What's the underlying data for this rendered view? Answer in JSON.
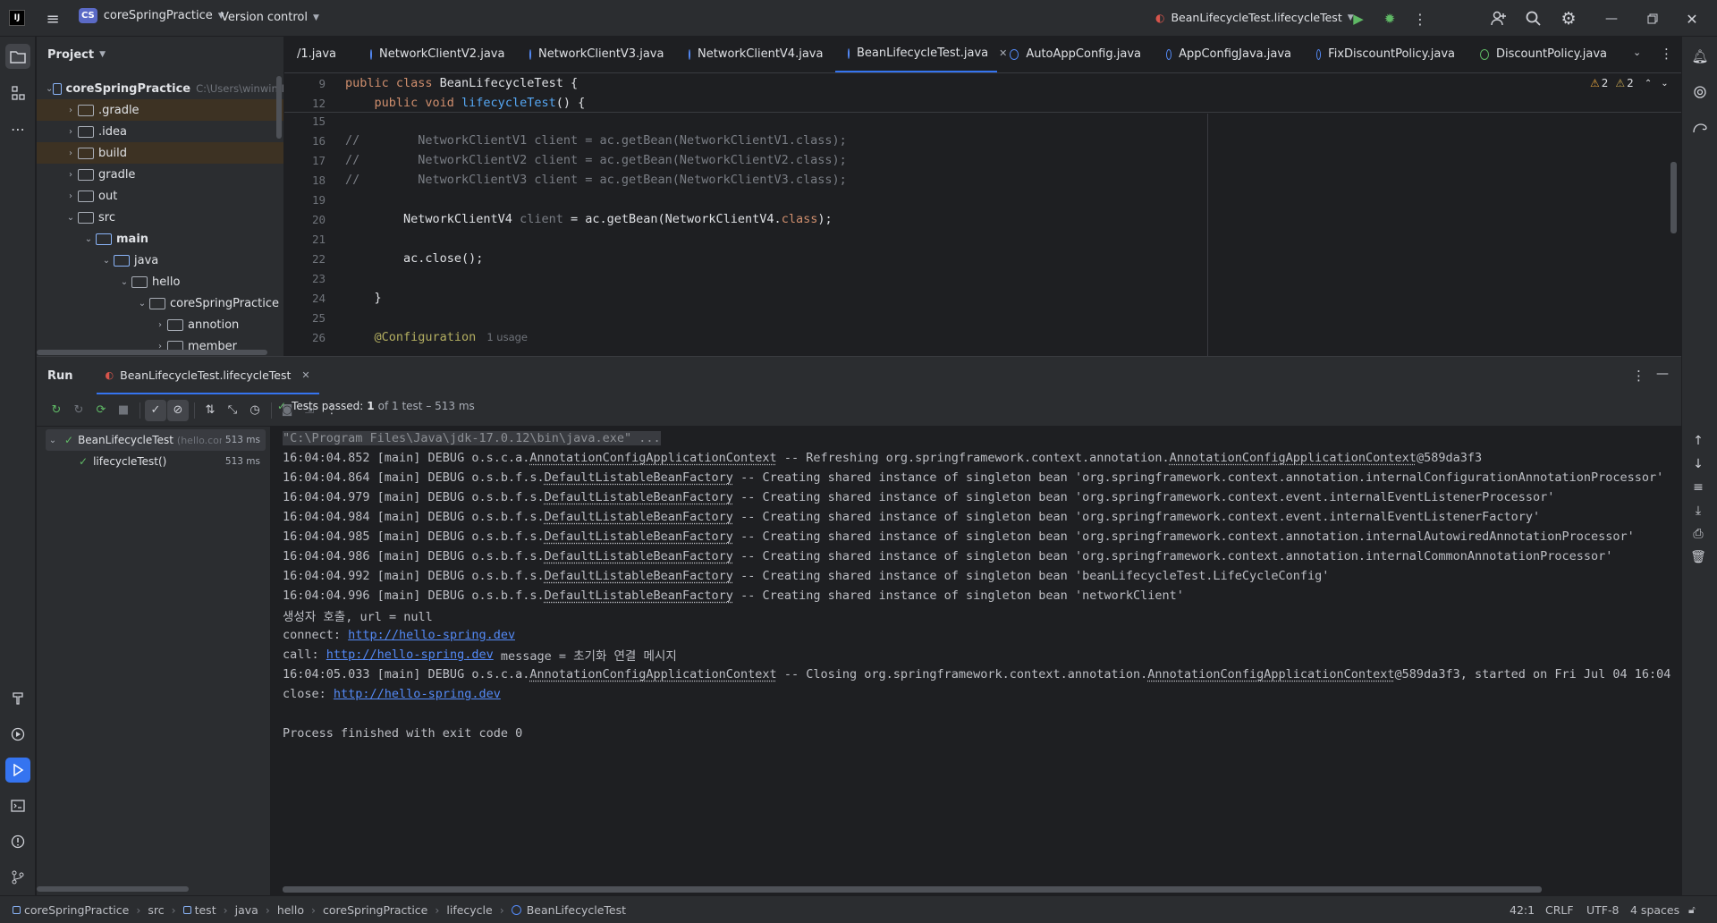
{
  "titlebar": {
    "project_badge": "CS",
    "project_name": "coreSpringPractice",
    "vcs_label": "Version control",
    "run_config": "BeanLifecycleTest.lifecycleTest"
  },
  "project_panel": {
    "title": "Project",
    "root_name": "coreSpringPractice",
    "root_path": "C:\\Users\\winwin\\I",
    "items": [
      {
        "label": ".gradle"
      },
      {
        "label": ".idea"
      },
      {
        "label": "build"
      },
      {
        "label": "gradle"
      },
      {
        "label": "out"
      },
      {
        "label": "src"
      },
      {
        "label": "main"
      },
      {
        "label": "java"
      },
      {
        "label": "hello"
      },
      {
        "label": "coreSpringPractice"
      },
      {
        "label": "annotion"
      },
      {
        "label": "member"
      }
    ]
  },
  "editor": {
    "tabs": [
      {
        "label": "/1.java"
      },
      {
        "label": "NetworkClientV2.java"
      },
      {
        "label": "NetworkClientV3.java"
      },
      {
        "label": "NetworkClientV4.java"
      },
      {
        "label": "BeanLifecycleTest.java"
      },
      {
        "label": "AutoAppConfig.java"
      },
      {
        "label": "AppConfigJava.java"
      },
      {
        "label": "FixDiscountPolicy.java"
      },
      {
        "label": "DiscountPolicy.java"
      }
    ],
    "warnings_a": "2",
    "warnings_b": "2",
    "sticky": [
      {
        "num": "9",
        "p1": "public class ",
        "p2": "BeanLifecycleTest {"
      },
      {
        "num": "12",
        "p1": "    public void ",
        "p2": "lifecycleTest",
        "p3": "() {"
      }
    ],
    "lines": [
      {
        "num": "15",
        "text": ""
      },
      {
        "num": "16",
        "text": "//        NetworkClientV1 client = ac.getBean(NetworkClientV1.class);"
      },
      {
        "num": "17",
        "text": "//        NetworkClientV2 client = ac.getBean(NetworkClientV2.class);"
      },
      {
        "num": "18",
        "text": "//        NetworkClientV3 client = ac.getBean(NetworkClientV3.class);"
      },
      {
        "num": "19",
        "text": ""
      },
      {
        "num": "20",
        "a": "        NetworkClientV4 ",
        "b": "client",
        "c": " = ac.getBean(NetworkClientV4.",
        "d": "class",
        "e": ");"
      },
      {
        "num": "21",
        "text": ""
      },
      {
        "num": "22",
        "text": "        ac.close();"
      },
      {
        "num": "23",
        "text": ""
      },
      {
        "num": "24",
        "text": "    }"
      },
      {
        "num": "25",
        "text": ""
      },
      {
        "num": "26",
        "ann": "    @Configuration",
        "usage": "1 usage"
      }
    ]
  },
  "run": {
    "title": "Run",
    "tab_label": "BeanLifecycleTest.lifecycleTest",
    "tests_passed_label": "Tests passed:",
    "tests_passed_count": "1",
    "tests_passed_detail": "of 1 test – 513 ms",
    "tree": [
      {
        "label": "BeanLifecycleTest",
        "sub": "(hello.core",
        "time": "513 ms"
      },
      {
        "label": "lifecycleTest()",
        "time": "513 ms"
      }
    ],
    "console": {
      "cmd": "\"C:\\Program Files\\Java\\jdk-17.0.12\\bin\\java.exe\" ...",
      "logs": [
        {
          "pre": "16:04:04.852 [main] DEBUG o.s.c.a.",
          "cls": "AnnotationConfigApplicationContext",
          "mid": " -- Refreshing org.springframework.context.annotation.",
          "cls2": "AnnotationConfigApplicationContext",
          "post": "@589da3f3"
        },
        {
          "pre": "16:04:04.864 [main] DEBUG o.s.b.f.s.",
          "cls": "DefaultListableBeanFactory",
          "mid": " -- Creating shared instance of singleton bean 'org.springframework.context.annotation.internalConfigurationAnnotationProcessor'"
        },
        {
          "pre": "16:04:04.979 [main] DEBUG o.s.b.f.s.",
          "cls": "DefaultListableBeanFactory",
          "mid": " -- Creating shared instance of singleton bean 'org.springframework.context.event.internalEventListenerProcessor'"
        },
        {
          "pre": "16:04:04.984 [main] DEBUG o.s.b.f.s.",
          "cls": "DefaultListableBeanFactory",
          "mid": " -- Creating shared instance of singleton bean 'org.springframework.context.event.internalEventListenerFactory'"
        },
        {
          "pre": "16:04:04.985 [main] DEBUG o.s.b.f.s.",
          "cls": "DefaultListableBeanFactory",
          "mid": " -- Creating shared instance of singleton bean 'org.springframework.context.annotation.internalAutowiredAnnotationProcessor'"
        },
        {
          "pre": "16:04:04.986 [main] DEBUG o.s.b.f.s.",
          "cls": "DefaultListableBeanFactory",
          "mid": " -- Creating shared instance of singleton bean 'org.springframework.context.annotation.internalCommonAnnotationProcessor'"
        },
        {
          "pre": "16:04:04.992 [main] DEBUG o.s.b.f.s.",
          "cls": "DefaultListableBeanFactory",
          "mid": " -- Creating shared instance of singleton bean 'beanLifecycleTest.LifeCycleConfig'"
        },
        {
          "pre": "16:04:04.996 [main] DEBUG o.s.b.f.s.",
          "cls": "DefaultListableBeanFactory",
          "mid": " -- Creating shared instance of singleton bean 'networkClient'"
        }
      ],
      "ctor": "생성자 호출, url = null",
      "connect_label": "connect: ",
      "url": "http://hello-spring.dev",
      "call_label": "call: ",
      "call_msg": " message = 초기화 연결 메시지",
      "closing": {
        "pre": "16:04:05.033 [main] DEBUG o.s.c.a.",
        "cls": "AnnotationConfigApplicationContext",
        "mid": " -- Closing org.springframework.context.annotation.",
        "cls2": "AnnotationConfigApplicationContext",
        "post": "@589da3f3, started on Fri Jul 04 16:04"
      },
      "close_label": "close: ",
      "exit": "Process finished with exit code 0"
    }
  },
  "statusbar": {
    "crumbs": [
      "coreSpringPractice",
      "src",
      "test",
      "java",
      "hello",
      "coreSpringPractice",
      "lifecycle",
      "BeanLifecycleTest"
    ],
    "position": "42:1",
    "line_sep": "CRLF",
    "encoding": "UTF-8",
    "indent": "4 spaces"
  },
  "colors": {
    "accent": "#3574f0",
    "link": "#548af7",
    "pass": "#5fb865",
    "keyword": "#cf8e6d"
  }
}
